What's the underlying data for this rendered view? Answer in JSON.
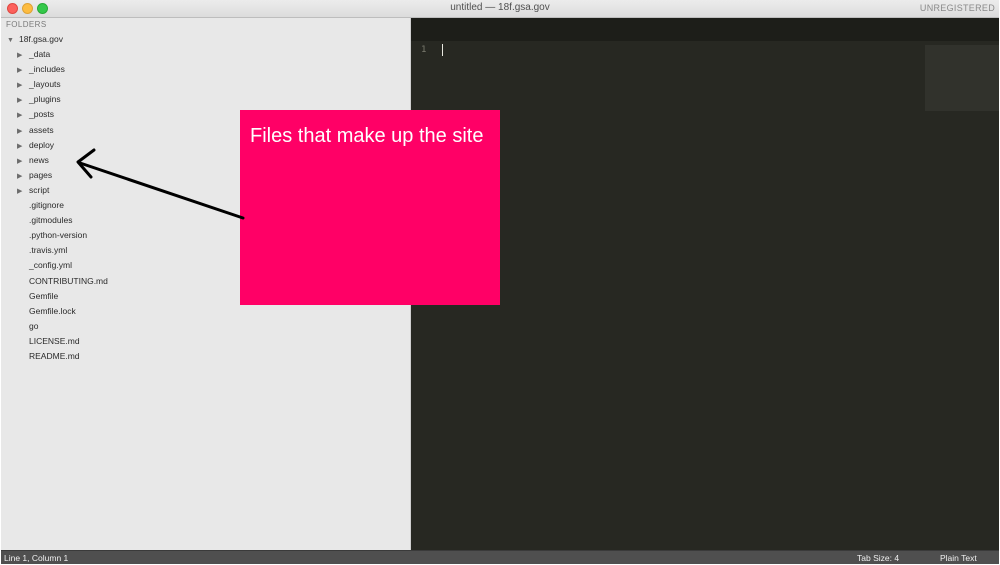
{
  "window": {
    "title": "untitled — 18f.gsa.gov",
    "license_status": "UNREGISTERED"
  },
  "sidebar": {
    "header": "FOLDERS",
    "root": {
      "label": "18f.gsa.gov",
      "expanded": true
    },
    "items": [
      {
        "label": "_data",
        "type": "folder"
      },
      {
        "label": "_includes",
        "type": "folder"
      },
      {
        "label": "_layouts",
        "type": "folder"
      },
      {
        "label": "_plugins",
        "type": "folder"
      },
      {
        "label": "_posts",
        "type": "folder"
      },
      {
        "label": "assets",
        "type": "folder"
      },
      {
        "label": "deploy",
        "type": "folder"
      },
      {
        "label": "news",
        "type": "folder"
      },
      {
        "label": "pages",
        "type": "folder"
      },
      {
        "label": "script",
        "type": "folder"
      },
      {
        "label": ".gitignore",
        "type": "file"
      },
      {
        "label": ".gitmodules",
        "type": "file"
      },
      {
        "label": ".python-version",
        "type": "file"
      },
      {
        "label": ".travis.yml",
        "type": "file"
      },
      {
        "label": "_config.yml",
        "type": "file"
      },
      {
        "label": "CONTRIBUTING.md",
        "type": "file"
      },
      {
        "label": "Gemfile",
        "type": "file"
      },
      {
        "label": "Gemfile.lock",
        "type": "file"
      },
      {
        "label": "go",
        "type": "file"
      },
      {
        "label": "LICENSE.md",
        "type": "file"
      },
      {
        "label": "README.md",
        "type": "file"
      }
    ]
  },
  "editor": {
    "line_numbers": [
      "1"
    ],
    "background_color": "#272822"
  },
  "status_bar": {
    "position": "Line 1, Column 1",
    "tab_size": "Tab Size: 4",
    "syntax": "Plain Text"
  },
  "annotation": {
    "text": "Files that make up the site",
    "color": "#ff0066"
  }
}
